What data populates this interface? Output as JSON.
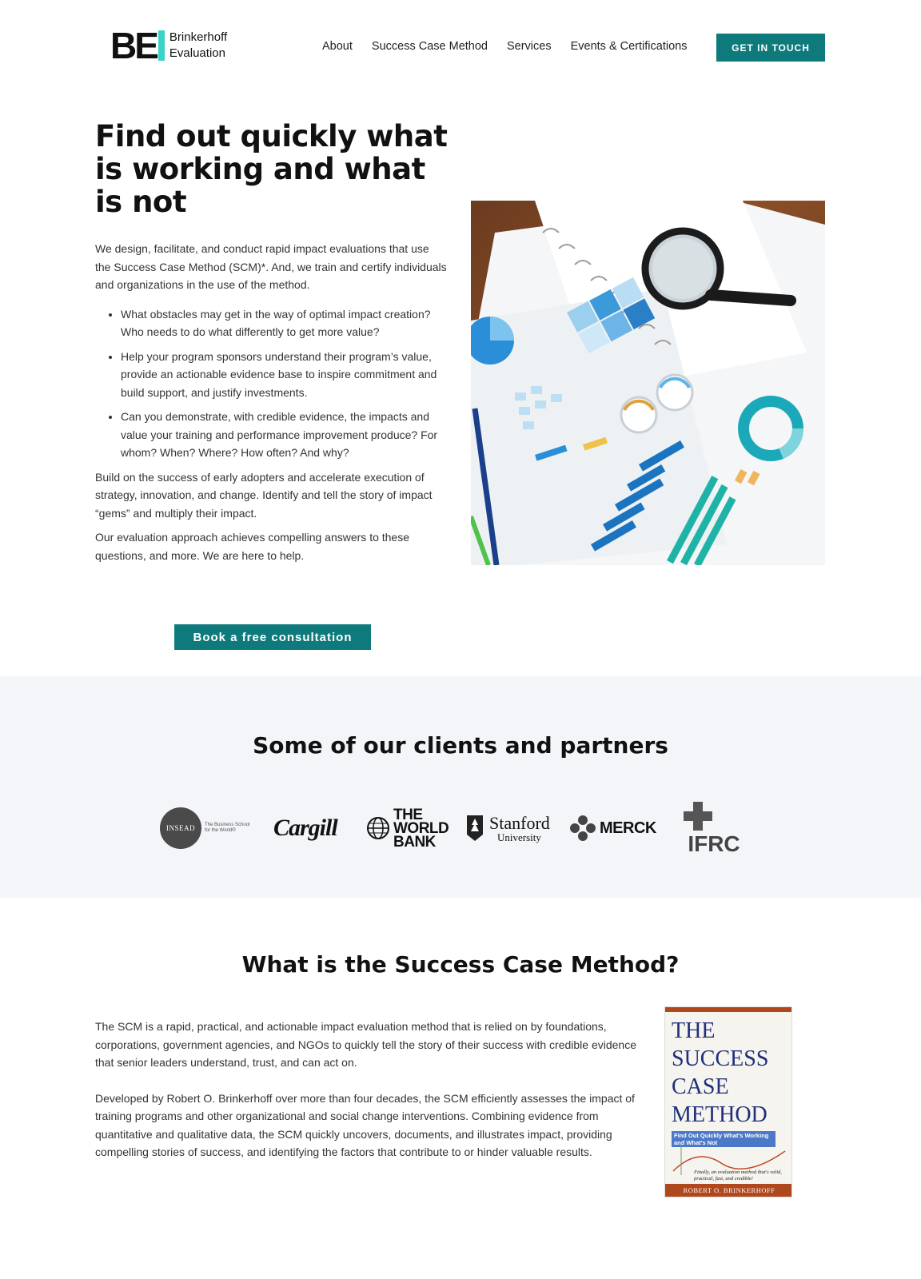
{
  "header": {
    "logo_mark": "BE",
    "logo_line1": "Brinkerhoff",
    "logo_line2": "Evaluation",
    "nav": [
      "About",
      "Success Case Method",
      "Services",
      "Events & Certifications"
    ],
    "cta": "GET IN TOUCH",
    "accent": "#0f7a7b"
  },
  "hero": {
    "title": "Find out quickly what is working and what is not",
    "intro": "We design, facilitate, and conduct rapid impact evaluations that use the Success Case Method (SCM)*. And, we train and certify individuals and organizations in the use of the method.",
    "bullets": [
      "What obstacles may get in the way of optimal impact creation? Who needs to do what differently to get more value?",
      "Help your program sponsors understand their program’s value, provide an actionable evidence base to inspire commitment and build support, and justify investments.",
      "Can you demonstrate, with credible evidence, the impacts and value your training and performance improvement produce?  For whom? When? Where? How often? And why?"
    ],
    "para2": "Build on the success of early adopters and accelerate execution of strategy, innovation, and change. Identify and tell the story of impact “gems” and multiply their impact.",
    "para3": "Our evaluation approach achieves compelling answers to these questions, and more. We are here to help.",
    "button": "Book a free consultation"
  },
  "clients": {
    "title": "Some of our clients and partners",
    "logos": {
      "insead": "INSEAD",
      "insead_tag": "The Business School for the World®",
      "cargill": "Cargill",
      "worldbank": [
        "THE",
        "WORLD",
        "BANK"
      ],
      "stanford": "Stanford",
      "stanford_sub": "University",
      "merck": "MERCK",
      "ifrc": "IFRC"
    }
  },
  "scm": {
    "title": "What is the Success Case Method?",
    "para1": "The SCM is a rapid, practical, and actionable impact evaluation method that is relied on by foundations, corporations, government agencies, and NGOs to quickly tell the story of their success with credible evidence that senior leaders understand, trust, and can act on.",
    "para2": "Developed by Robert O. Brinkerhoff over more than four decades, the SCM efficiently assesses the impact of training programs and other organizational and social change interventions. Combining evidence from quantitative and qualitative data, the SCM quickly uncovers, documents, and illustrates impact, providing compelling stories of success, and identifying the factors that contribute to or hinder valuable results.",
    "book": {
      "title_lines": [
        "THE",
        "SUCCESS",
        "CASE",
        "METHOD"
      ],
      "subtitle": "Find Out Quickly What's Working and What's Not",
      "tagline": "Finally, an evaluation method that's valid, practical, fast, and credible!",
      "author": "ROBERT O. BRINKERHOFF"
    }
  }
}
